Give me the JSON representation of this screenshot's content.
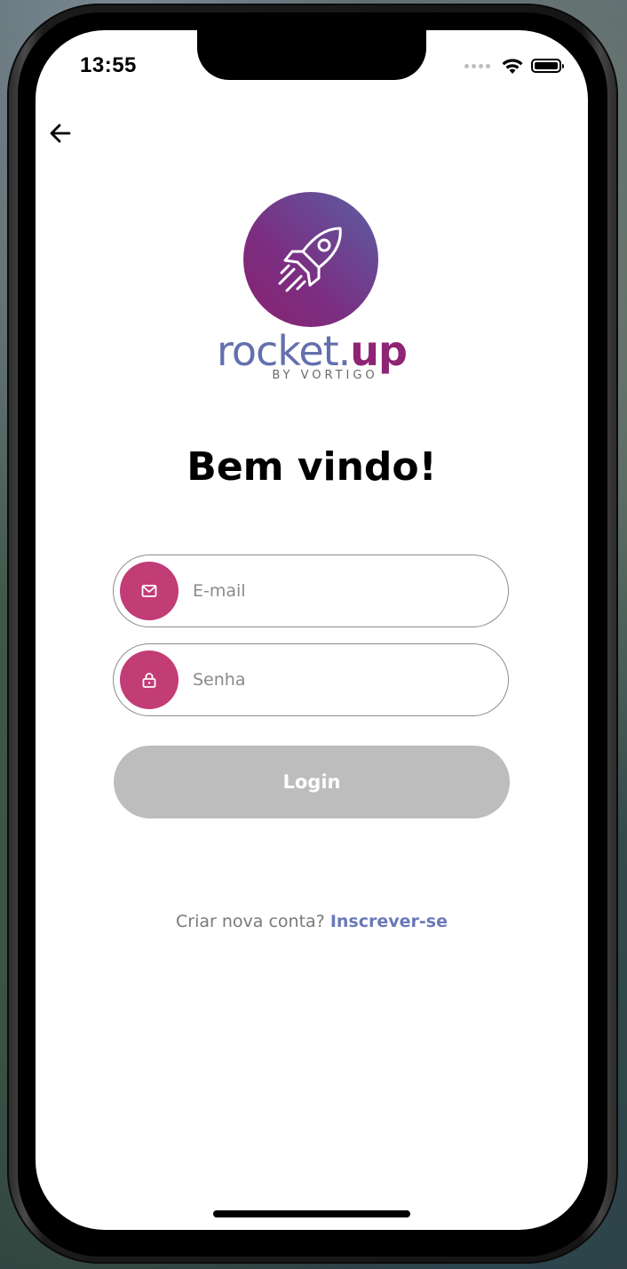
{
  "status_bar": {
    "time": "13:55",
    "battery_level": 1.0,
    "icons": [
      "signal-dots-icon",
      "wifi-icon",
      "battery-icon"
    ]
  },
  "nav": {
    "back_icon": "arrow-left-icon"
  },
  "brand": {
    "logo_icon": "rocket-icon",
    "name_part1": "rocket.",
    "name_part2": "up",
    "tagline": "BY VORTIGO"
  },
  "title": "Bem vindo!",
  "form": {
    "email": {
      "icon": "mail-icon",
      "placeholder": "E-mail",
      "value": ""
    },
    "password": {
      "icon": "lock-icon",
      "placeholder": "Senha",
      "value": ""
    },
    "login_label": "Login"
  },
  "signup": {
    "prompt": "Criar nova conta?",
    "link_label": "Inscrever-se"
  },
  "colors": {
    "accent_pink": "#c23c76",
    "brand_purple": "#8e2474",
    "brand_blue": "#6470ad",
    "link_blue": "#6b79b6",
    "button_disabled": "#bdbdbd"
  }
}
